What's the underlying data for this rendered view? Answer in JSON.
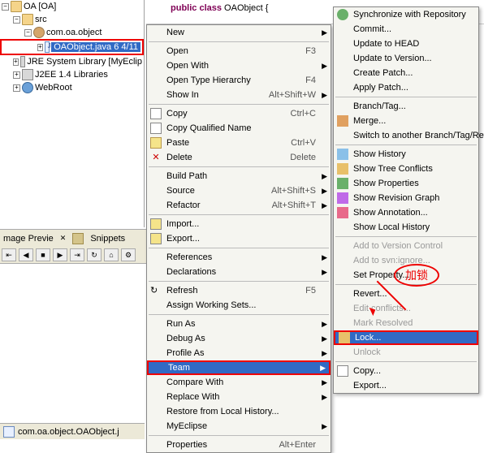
{
  "tree": {
    "project": "OA [OA]",
    "src": "src",
    "pkg": "com.oa.object",
    "file": "OAObject.java 6  4/11",
    "jre": "JRE System Library [MyEclip",
    "j2ee": "J2EE 1.4 Libraries",
    "webroot": "WebRoot"
  },
  "editor": {
    "kw_public": "public",
    "kw_class": "class",
    "classname": "OAObject",
    "brace": "{"
  },
  "tabs": {
    "preview": "mage Previe",
    "snippets": "Snippets"
  },
  "status": {
    "text": "com.oa.object.OAObject.j"
  },
  "menu1": {
    "new": "New",
    "open": "Open",
    "open_sc": "F3",
    "openwith": "Open With",
    "openhier": "Open Type Hierarchy",
    "openhier_sc": "F4",
    "showin": "Show In",
    "showin_sc": "Alt+Shift+W",
    "copy": "Copy",
    "copy_sc": "Ctrl+C",
    "copyq": "Copy Qualified Name",
    "paste": "Paste",
    "paste_sc": "Ctrl+V",
    "delete": "Delete",
    "delete_sc": "Delete",
    "build": "Build Path",
    "source": "Source",
    "source_sc": "Alt+Shift+S",
    "refactor": "Refactor",
    "refactor_sc": "Alt+Shift+T",
    "import": "Import...",
    "export": "Export...",
    "refs": "References",
    "decl": "Declarations",
    "refresh": "Refresh",
    "refresh_sc": "F5",
    "assign": "Assign Working Sets...",
    "runas": "Run As",
    "debugas": "Debug As",
    "profileas": "Profile As",
    "team": "Team",
    "compare": "Compare With",
    "replace": "Replace With",
    "restore": "Restore from Local History...",
    "myeclipse": "MyEclipse",
    "props": "Properties",
    "props_sc": "Alt+Enter"
  },
  "menu2": {
    "sync": "Synchronize with Repository",
    "commit": "Commit...",
    "uphead": "Update to HEAD",
    "upver": "Update to Version...",
    "patch": "Create Patch...",
    "apply": "Apply Patch...",
    "branch": "Branch/Tag...",
    "merge": "Merge...",
    "switch": "Switch to another Branch/Tag/Rev",
    "showhist": "Show History",
    "showtree": "Show Tree Conflicts",
    "showprops": "Show Properties",
    "revgraph": "Show Revision Graph",
    "annot": "Show Annotation...",
    "localhist": "Show Local History",
    "addvc": "Add to Version Control",
    "addign": "Add to svn:ignore...",
    "setprop": "Set Property...",
    "revert": "Revert...",
    "editconf": "Edit conflicts...",
    "markres": "Mark Resolved",
    "lock": "Lock...",
    "unlock": "Unlock",
    "copy2": "Copy...",
    "export2": "Export..."
  },
  "annotation": {
    "text": "加锁"
  }
}
